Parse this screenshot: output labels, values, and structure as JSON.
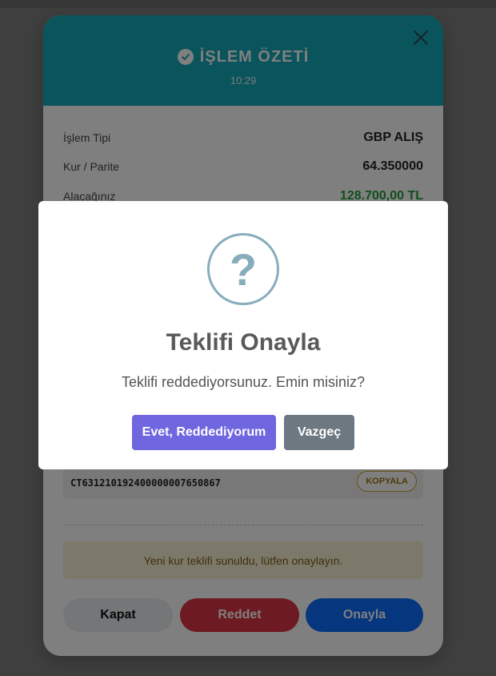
{
  "summary": {
    "title": "İŞLEM ÖZETİ",
    "time": "10:29",
    "rows": [
      {
        "label": "İşlem Tipi",
        "value": "GBP ALIŞ"
      },
      {
        "label": "Kur / Parite",
        "value": "64.350000"
      },
      {
        "label": "Alacağınız",
        "value": "128.700,00 TL"
      }
    ],
    "reference": "CT631210192400000007650867",
    "copy_label": "KOPYALA",
    "notice": "Yeni kur teklifi sunuldu, lütfen onaylayın.",
    "buttons": {
      "close": "Kapat",
      "reject": "Reddet",
      "approve": "Onayla"
    }
  },
  "dialog": {
    "icon_symbol": "?",
    "title": "Teklifi Onayla",
    "text": "Teklifi reddediyorsunuz. Emin misiniz?",
    "confirm_label": "Evet, Reddediyorum",
    "cancel_label": "Vazgeç"
  },
  "colors": {
    "header": "#14a9b8",
    "amount_green": "#1e9e3b",
    "reject": "#dc3545",
    "approve": "#0d6efd",
    "dialog_confirm": "#7066e0",
    "dialog_cancel": "#6e7881",
    "question_icon": "#87adbd"
  }
}
